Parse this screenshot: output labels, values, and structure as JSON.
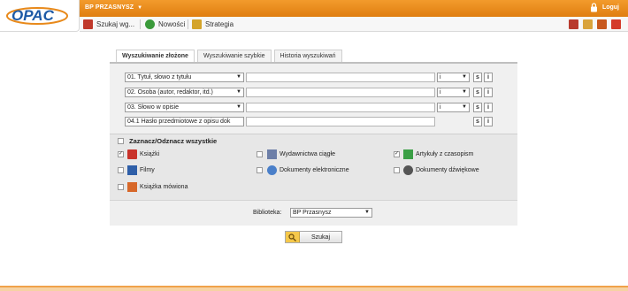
{
  "header": {
    "logo_text": "OPAC",
    "library_title": "BP PRZASNYSZ",
    "login_label": "Loguj"
  },
  "toolbar": {
    "items": [
      {
        "label": "Szukaj wg...",
        "icon": "search-book-icon"
      },
      {
        "label": "Nowości",
        "icon": "refresh-icon"
      },
      {
        "label": "Strategia",
        "icon": "books-icon"
      }
    ]
  },
  "tabs": [
    {
      "label": "Wyszukiwanie złożone"
    },
    {
      "label": "Wyszukiwanie szybkie"
    },
    {
      "label": "Historia wyszukiwań"
    }
  ],
  "search_rows": [
    {
      "field": "01. Tytuł, słowo z tytułu",
      "operator": "i"
    },
    {
      "field": "02. Osoba (autor, redaktor, itd.)",
      "operator": "i"
    },
    {
      "field": "03. Słowo w opisie",
      "operator": "i"
    },
    {
      "field": "04.1 Hasło przedmiotowe z opisu dok"
    }
  ],
  "row_buttons": {
    "s": "s",
    "i": "i"
  },
  "materials": {
    "select_all": "Zaznacz/Odznacz wszystkie",
    "items": [
      {
        "label": "Książki",
        "checked": true
      },
      {
        "label": "Wydawnictwa ciągłe",
        "checked": false
      },
      {
        "label": "Artykuły z czasopism",
        "checked": true
      },
      {
        "label": "Filmy",
        "checked": false
      },
      {
        "label": "Dokumenty elektroniczne",
        "checked": false
      },
      {
        "label": "Dokumenty dźwiękowe",
        "checked": false
      },
      {
        "label": "Książka mówiona",
        "checked": false
      }
    ]
  },
  "library": {
    "label": "Biblioteka:",
    "value": "BP Przasnysz"
  },
  "search_button": "Szukaj",
  "colors": {
    "accent": "#e8891a",
    "panel": "#f0f0f0"
  }
}
